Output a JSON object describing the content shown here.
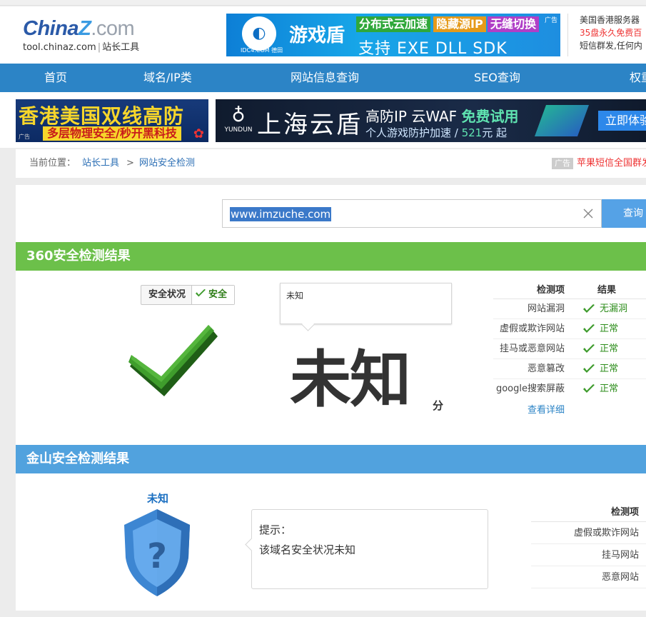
{
  "header": {
    "logo_main": "China",
    "logo_z": "Z",
    "logo_dotcom": ".com",
    "logo_domain": "tool.chinaz.com",
    "logo_sub_sep": "|",
    "logo_tagline": "站长工具"
  },
  "ad_top": {
    "badge_text": "IDC4.COM 德田",
    "title": "游戏盾",
    "chips": [
      "分布式云加速",
      "隐藏源IP",
      "无缝切换"
    ],
    "line2": "支持  EXE  DLL  SDK",
    "ad_tag": "广告"
  },
  "text_ad": {
    "line1": "美国香港服务器",
    "line2": "35盘永久免费百",
    "line3": "短信群发,任何内"
  },
  "nav": {
    "items": [
      "首页",
      "域名/IP类",
      "网站信息查询",
      "SEO查询",
      "权重"
    ]
  },
  "ad_row": {
    "hk_title": "香港美国双线高防",
    "hk_sub": "多层物理安全/秒开黑科技",
    "hk_ad_tag": "广告",
    "yd_brand": "YUNDUN",
    "yd_title": "上海云盾",
    "yd_line1_a": "高防IP 云WAF ",
    "yd_line1_free": "免费试用",
    "yd_line2_a": "个人游戏防护加速 / ",
    "yd_line2_num": "521",
    "yd_line2_b": "元 起",
    "yd_btn": "立即体验"
  },
  "breadcrumb": {
    "label": "当前位置：",
    "item1": "站长工具",
    "sep": ">",
    "item2": "网站安全检测",
    "ad_tag": "广告",
    "ad_text": "苹果短信全国群发"
  },
  "search": {
    "value": "www.imzuche.com",
    "button": "查询"
  },
  "sec360": {
    "title": "360安全检测结果",
    "status_label": "安全状况",
    "status_value": "安全",
    "bubble_text": "未知",
    "score": "未知",
    "score_unit": "分",
    "table_header_item": "检测项",
    "table_header_result": "结果",
    "rows": [
      {
        "item": "网站漏洞",
        "result": "无漏洞"
      },
      {
        "item": "虚假或欺诈网站",
        "result": "正常"
      },
      {
        "item": "挂马或恶意网站",
        "result": "正常"
      },
      {
        "item": "恶意篡改",
        "result": "正常"
      },
      {
        "item": "google搜索屏蔽",
        "result": "正常"
      }
    ],
    "detail_link": "查看详细"
  },
  "kingsoft": {
    "title": "金山安全检测结果",
    "status": "未知",
    "hint_title": "提示：",
    "hint_text": "该域名安全状况未知",
    "table_header": "检测项",
    "rows": [
      "虚假或欺诈网站",
      "挂马网站",
      "恶意网站"
    ]
  },
  "colors": {
    "nav_bg": "#2c84c6",
    "sec360_bg": "#6cc04a",
    "kingsoft_bg": "#51a2de",
    "result_green": "#2f8e1d",
    "link_blue": "#2c84c6"
  }
}
